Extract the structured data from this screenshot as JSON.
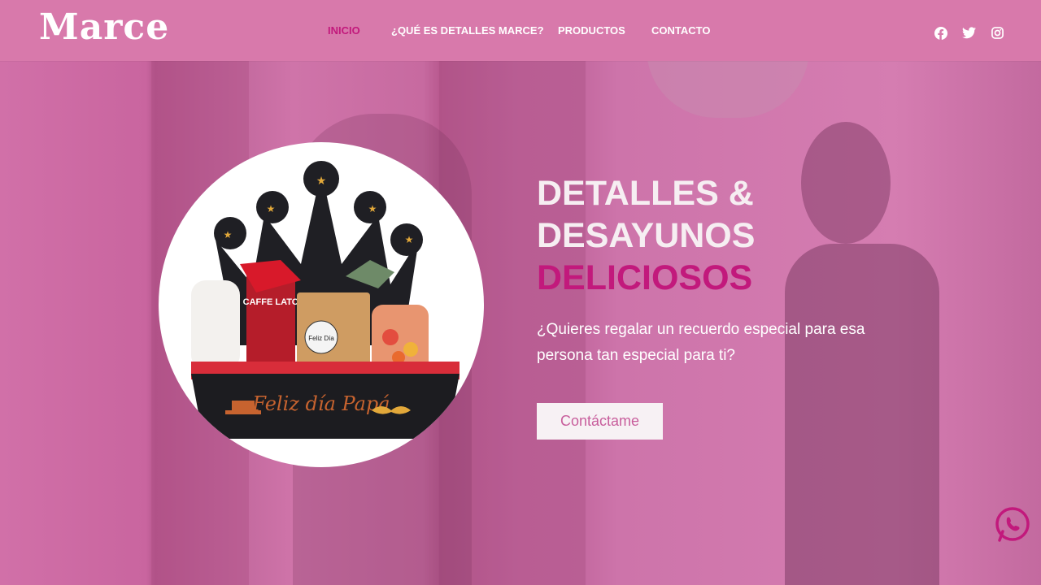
{
  "header": {
    "logo": "Marce",
    "nav": [
      {
        "label": "INICIO",
        "active": true
      },
      {
        "label": "¿QUÉ ES DETALLES MARCE?",
        "active": false
      },
      {
        "label": "PRODUCTOS",
        "active": false
      },
      {
        "label": "CONTACTO",
        "active": false
      }
    ],
    "socials": [
      "facebook-icon",
      "twitter-icon",
      "instagram-icon"
    ]
  },
  "hero": {
    "title_line1": "DETALLES &",
    "title_line2": "DESAYUNOS",
    "title_line3": "DELICIOSOS",
    "subtitle": "¿Quieres regalar un recuerdo especial para esa persona tan especial para ti?",
    "cta_label": "Contáctame"
  },
  "product_image": {
    "box_text": "Feliz día Papá",
    "tag_text": "Feliz Día",
    "bottle_text": "CAFFE LATO"
  },
  "colors": {
    "header_bg": "#d879ab",
    "accent": "#c2197c",
    "hero_overlay": "#c7679e"
  }
}
